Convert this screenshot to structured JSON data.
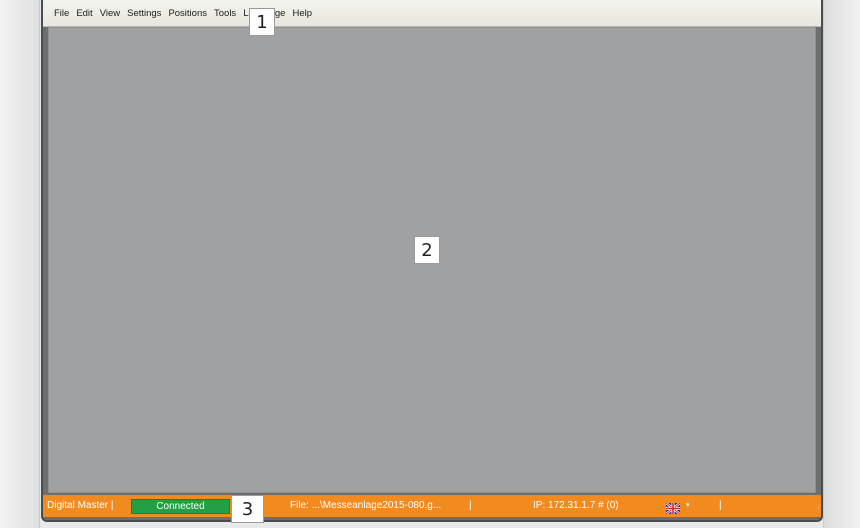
{
  "menubar": {
    "items": [
      "File",
      "Edit",
      "View",
      "Settings",
      "Positions",
      "Tools",
      "Language",
      "Help"
    ]
  },
  "statusbar": {
    "app_name": "Digital Master |",
    "connection_status": "Connected",
    "file_path": "File: ...\\Messeanlage2015-080.g...",
    "separator": "|",
    "ip_info": "IP: 172.31.1.7 # (0)",
    "language_flag_icon": "uk-flag-icon",
    "dropdown_glyph": "▾",
    "grip_glyph": "⋰",
    "colors": {
      "bar": "#f18a1f",
      "connected": "#23a046"
    }
  },
  "callouts": {
    "one": "1",
    "two": "2",
    "three": "3"
  }
}
